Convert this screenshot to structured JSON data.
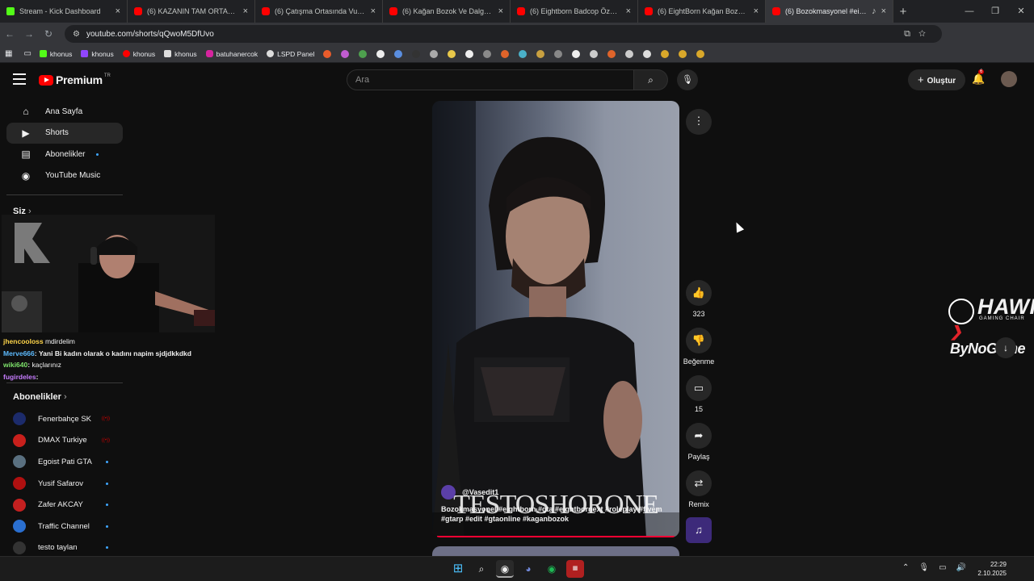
{
  "browser": {
    "tabs": [
      {
        "title": "Stream - Kick Dashboard",
        "favicon": "kick-icon"
      },
      {
        "title": "(6) KAZANIN TAM ORTASINDA",
        "favicon": "youtube-icon"
      },
      {
        "title": "(6) Çatışma Ortasında Vurulan",
        "favicon": "youtube-icon"
      },
      {
        "title": "(6) Kağan Bozok Ve Dalgası 2",
        "favicon": "youtube-icon"
      },
      {
        "title": "(6) Eightborn Badcop Özet Kağ",
        "favicon": "youtube-icon"
      },
      {
        "title": "(6) EightBorn Kağan Bozok | Ki",
        "favicon": "youtube-icon"
      },
      {
        "title": "(6) Bozokmasyonel #eightb",
        "favicon": "youtube-icon"
      }
    ],
    "url": "youtube.com/shorts/qQwoM5DfUvo",
    "bookmarks": [
      "khonus",
      "khonus",
      "khonus",
      "khonus",
      "batuhanercok",
      "LSPD Panel"
    ]
  },
  "header": {
    "logo_text": "Premium",
    "logo_region": "TR",
    "search_placeholder": "Ara",
    "create_label": "Oluştur",
    "notification_count": "6"
  },
  "sidebar": {
    "items": [
      {
        "label": "Ana Sayfa",
        "icon": "home-icon"
      },
      {
        "label": "Shorts",
        "icon": "shorts-icon"
      },
      {
        "label": "Abonelikler",
        "icon": "subscriptions-icon"
      },
      {
        "label": "YouTube Music",
        "icon": "music-icon"
      }
    ],
    "you_label": "Siz",
    "subscriptions_label": "Abonelikler",
    "subscriptions": [
      {
        "name": "Fenerbahçe SK",
        "color": "#1c2b6b"
      },
      {
        "name": "DMAX Turkiye",
        "color": "#c8201c"
      },
      {
        "name": "Egoist Pati GTA",
        "color": "#5a7080"
      },
      {
        "name": "Yusif Safarov",
        "color": "#b01010"
      },
      {
        "name": "Zafer AKCAY",
        "color": "#c42020"
      },
      {
        "name": "Traffic Channel",
        "color": "#2a6fd0"
      },
      {
        "name": "testo taylan",
        "color": "#333333"
      }
    ]
  },
  "chat": [
    {
      "user": "jhencooloss",
      "text": "mdirdelim",
      "color": "#ffd54a"
    },
    {
      "user": "Merve666",
      "text": "Yani Bi kadın olarak o kadını napim sjdjdkkdkd",
      "color": "#5dbbff"
    },
    {
      "user": "wiki640",
      "text": "kaçlarınız",
      "color": "#7ee36b"
    },
    {
      "user": "fugirdeles",
      "text": "",
      "color": "#c77dff"
    }
  ],
  "video": {
    "channel": "@Vasedit1",
    "overlay_text": "TESTOSHORONE",
    "description": "Bozokmasyonel #eightborn #gta #eightbornext #roleplay #fivem #gtarp #edit #gtaonline #kaganbozok"
  },
  "actions": {
    "likes": "323",
    "dislike_label": "Beğenme",
    "comments": "15",
    "share_label": "Paylaş",
    "remix_label": "Remix"
  },
  "overlay": {
    "hawk": "HAWK",
    "hawk_sub": "GAMING CHAIR",
    "bynogame": "ByNoGame"
  },
  "taskbar": {
    "time": "22:29",
    "date": "2.10.2025"
  },
  "colors": {
    "youtube_red": "#ff0000",
    "accent_blue": "#3ea6ff",
    "kick_green": "#53fc18"
  }
}
